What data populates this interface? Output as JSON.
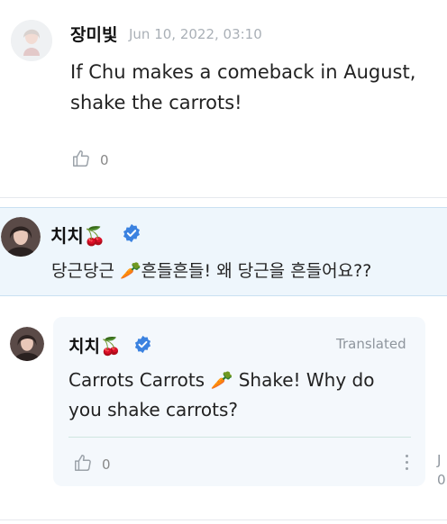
{
  "comment1": {
    "author": "장미빛",
    "date": "Jun 10, 2022, 03:10",
    "line1": "If Chu makes a comeback in August,",
    "line2": "shake the carrots!",
    "likes": "0"
  },
  "reply": {
    "author": "치치🍒",
    "text": "당근당근 🥕흔들흔들!  왜 당근을 흔들어요??"
  },
  "translation": {
    "author": "치치🍒",
    "label": "Translated",
    "line1": "Carrots Carrots 🥕  Shake! Why do",
    "line2": "you shake carrots?",
    "likes": "0"
  },
  "cut_off": {
    "line1": "J",
    "line2": "0"
  },
  "colors": {
    "verified": "#3b82e0",
    "reply_bg": "#eef6fc",
    "card_bg": "#f4f8fc"
  },
  "icons": [
    "thumbs-up-icon",
    "verified-badge-icon",
    "more-options-icon"
  ]
}
